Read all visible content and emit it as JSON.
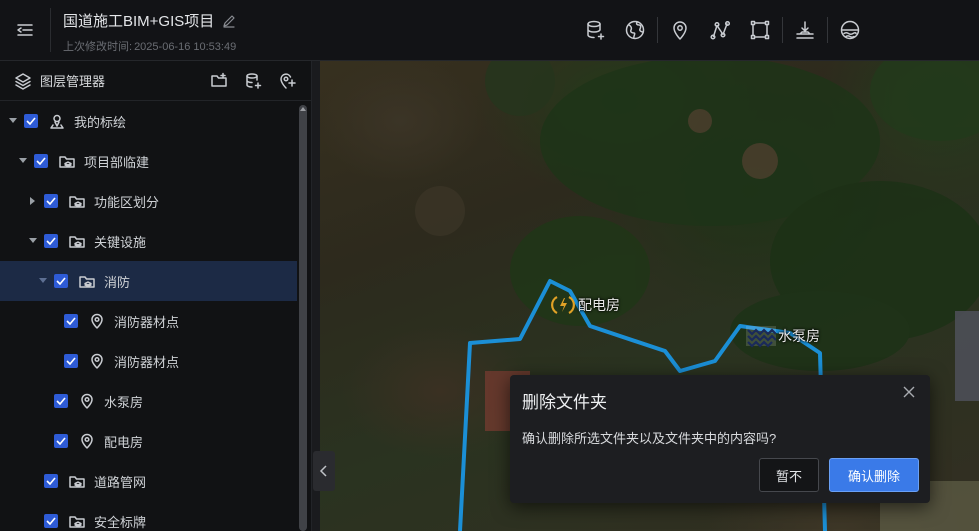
{
  "header": {
    "project_title": "国道施工BIM+GIS项目",
    "last_modified_label": "上次修改时间:",
    "last_modified_value": "2025-06-16 10:53:49",
    "toolbar_icons": [
      "database-add-icon",
      "globe-icon",
      "map-pin-icon",
      "polyline-icon",
      "polygon-icon",
      "terrain-flatten-icon",
      "water-level-icon"
    ]
  },
  "sidebar": {
    "title": "图层管理器",
    "actions": [
      "add-folder-icon",
      "add-data-icon",
      "add-marker-icon"
    ],
    "tree": [
      {
        "label": "我的标绘",
        "level": 0,
        "expanded": true,
        "icon": "user-pin-icon",
        "has_children": true
      },
      {
        "label": "项目部临建",
        "level": 1,
        "expanded": true,
        "icon": "folder-layers-icon",
        "has_children": true
      },
      {
        "label": "功能区划分",
        "level": 2,
        "expanded": false,
        "icon": "folder-layers-icon",
        "has_children": true
      },
      {
        "label": "关键设施",
        "level": 2,
        "expanded": true,
        "icon": "folder-layers-icon",
        "has_children": true
      },
      {
        "label": "消防",
        "level": 3,
        "expanded": true,
        "icon": "folder-layers-icon",
        "has_children": true,
        "active": true
      },
      {
        "label": "消防器材点",
        "level": 4,
        "icon": "map-pin-icon",
        "has_children": false
      },
      {
        "label": "消防器材点",
        "level": 4,
        "icon": "map-pin-icon",
        "has_children": false
      },
      {
        "label": "水泵房",
        "level": 3,
        "icon": "map-pin-icon",
        "has_children": false
      },
      {
        "label": "配电房",
        "level": 3,
        "icon": "map-pin-icon",
        "has_children": false
      },
      {
        "label": "道路管网",
        "level": 2,
        "icon": "folder-layers-icon",
        "has_children": false
      },
      {
        "label": "安全标牌",
        "level": 2,
        "icon": "folder-layers-icon",
        "has_children": false
      }
    ]
  },
  "map": {
    "labels": [
      {
        "text": "配电房",
        "icon": "power-icon"
      },
      {
        "text": "水泵房",
        "icon": "water-wave-icon"
      }
    ],
    "boundary_color": "#1b8fd6",
    "accent_color": "#e0a126"
  },
  "dialog": {
    "title": "删除文件夹",
    "message": "确认删除所选文件夹以及文件夹中的内容吗?",
    "cancel_label": "暂不",
    "confirm_label": "确认删除"
  }
}
